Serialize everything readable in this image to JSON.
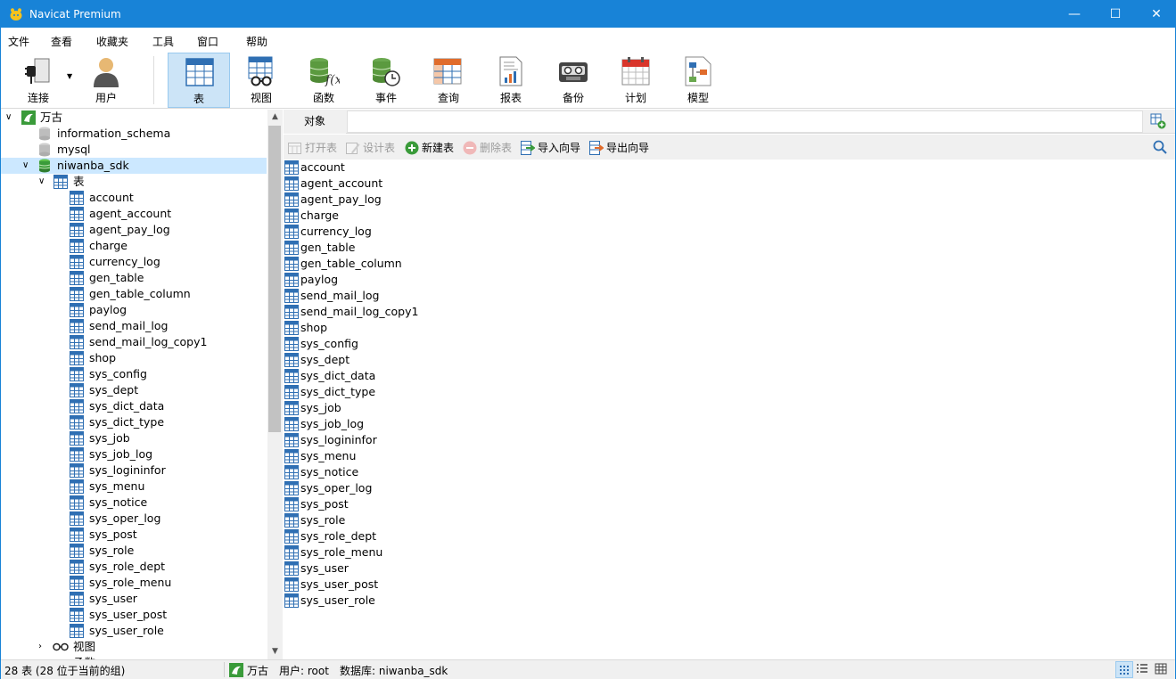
{
  "app": {
    "title": "Navicat Premium"
  },
  "window_controls": {
    "minimize": "—",
    "maximize": "☐",
    "close": "✕"
  },
  "menu": [
    "文件",
    "查看",
    "收藏夹",
    "工具",
    "窗口",
    "帮助"
  ],
  "toolbar": {
    "connect": "连接",
    "user": "用户",
    "table": "表",
    "view": "视图",
    "function": "函数",
    "event": "事件",
    "query": "查询",
    "report": "报表",
    "backup": "备份",
    "schedule": "计划",
    "model": "模型",
    "active": "table"
  },
  "tree": {
    "connection": "万古",
    "databases": [
      "information_schema",
      "mysql",
      "niwanba_sdk"
    ],
    "open_database": "niwanba_sdk",
    "tables_node": "表",
    "tables": [
      "account",
      "agent_account",
      "agent_pay_log",
      "charge",
      "currency_log",
      "gen_table",
      "gen_table_column",
      "paylog",
      "send_mail_log",
      "send_mail_log_copy1",
      "shop",
      "sys_config",
      "sys_dept",
      "sys_dict_data",
      "sys_dict_type",
      "sys_job",
      "sys_job_log",
      "sys_logininfor",
      "sys_menu",
      "sys_notice",
      "sys_oper_log",
      "sys_post",
      "sys_role",
      "sys_role_dept",
      "sys_role_menu",
      "sys_user",
      "sys_user_post",
      "sys_user_role"
    ],
    "views_node": "视图",
    "functions_node": "函数"
  },
  "tabs": {
    "objects": "对象"
  },
  "object_toolbar": {
    "open_table": "打开表",
    "design_table": "设计表",
    "new_table": "新建表",
    "delete_table": "删除表",
    "import_wizard": "导入向导",
    "export_wizard": "导出向导"
  },
  "objects": [
    "account",
    "agent_account",
    "agent_pay_log",
    "charge",
    "currency_log",
    "gen_table",
    "gen_table_column",
    "paylog",
    "send_mail_log",
    "send_mail_log_copy1",
    "shop",
    "sys_config",
    "sys_dept",
    "sys_dict_data",
    "sys_dict_type",
    "sys_job",
    "sys_job_log",
    "sys_logininfor",
    "sys_menu",
    "sys_notice",
    "sys_oper_log",
    "sys_post",
    "sys_role",
    "sys_role_dept",
    "sys_role_menu",
    "sys_user",
    "sys_user_post",
    "sys_user_role"
  ],
  "status": {
    "count": "28 表 (28 位于当前的组)",
    "connection": "万古",
    "user": "用户: root",
    "database": "数据库: niwanba_sdk",
    "view_mode": "grid"
  },
  "colors": {
    "titlebar": "#1883d7",
    "selection": "#cce8ff",
    "toolbar_active": "#cce4f7",
    "table_icon_blue": "#2f6fb3",
    "db_green": "#3a9b3a"
  }
}
